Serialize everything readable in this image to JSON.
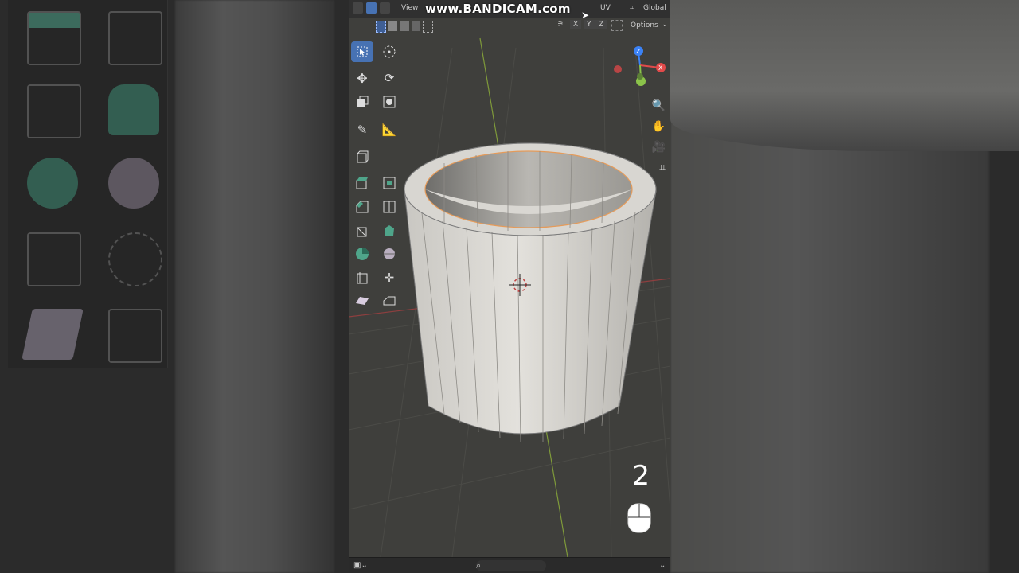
{
  "header": {
    "view_label": "View",
    "uv_label": "UV",
    "orientation_label": "Global",
    "watermark": "www.BANDICAM.com"
  },
  "subheader": {
    "axis_x": "X",
    "axis_y": "Y",
    "axis_z": "Z",
    "options_label": "Options"
  },
  "overlay": {
    "key_count": "2"
  },
  "colors": {
    "viewport_bg": "#3f3f3c",
    "header_bg": "#303030",
    "accent": "#4772b3",
    "tool_green": "#4fa58a",
    "axis_x": "#e24a4a",
    "axis_y": "#8bc34a",
    "axis_z": "#3b82f6"
  },
  "toolbar": {
    "tools": [
      {
        "name": "select-box-icon",
        "active": true
      },
      {
        "name": "cursor-icon",
        "active": false
      },
      {
        "name": "move-icon",
        "active": false
      },
      {
        "name": "rotate-icon",
        "active": false
      },
      {
        "name": "scale-icon",
        "active": false
      },
      {
        "name": "transform-icon",
        "active": false
      },
      {
        "name": "annotate-icon",
        "active": false
      },
      {
        "name": "measure-icon",
        "active": false
      },
      {
        "name": "add-cube-icon",
        "active": false
      },
      {
        "name": "extrude-region-icon",
        "active": false
      },
      {
        "name": "inset-faces-icon",
        "active": false
      },
      {
        "name": "bevel-icon",
        "active": false
      },
      {
        "name": "loop-cut-icon",
        "active": false
      },
      {
        "name": "knife-icon",
        "active": false
      },
      {
        "name": "poly-build-icon",
        "active": false
      },
      {
        "name": "spin-icon",
        "active": false
      },
      {
        "name": "smooth-icon",
        "active": false
      },
      {
        "name": "edge-slide-icon",
        "active": false
      },
      {
        "name": "shrink-fatten-icon",
        "active": false
      },
      {
        "name": "shear-icon",
        "active": false
      },
      {
        "name": "rip-region-icon",
        "active": false
      }
    ]
  },
  "navigation": [
    "zoom-icon",
    "hand-pan-icon",
    "camera-icon",
    "grid-view-icon"
  ]
}
